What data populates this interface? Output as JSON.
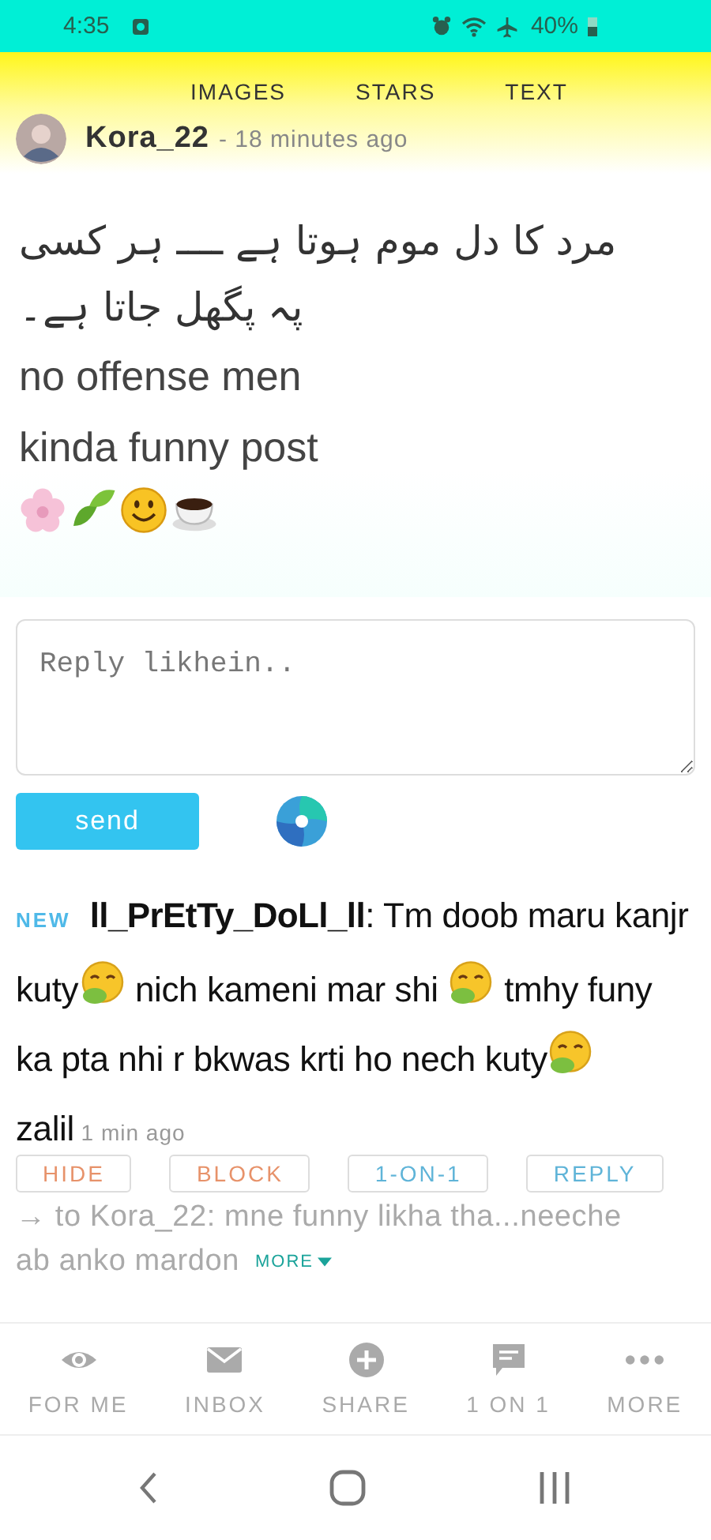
{
  "status_bar": {
    "time": "4:35",
    "battery": "40%"
  },
  "tabs": [
    {
      "label": "IMAGES",
      "selected": false
    },
    {
      "label": "STARS",
      "selected": false
    },
    {
      "label": "TEXT",
      "selected": false
    }
  ],
  "post": {
    "author": "Kora_22",
    "time": "- 18 minutes ago",
    "lines": [
      {
        "kind": "urdu",
        "text": "مرد کا دل موم ہوتا ہے ــــ ہر کسی پہ پگھل جاتا ہے۔"
      },
      {
        "kind": "plain",
        "text": "no offense men"
      },
      {
        "kind": "plain",
        "text": "kinda funny post"
      }
    ],
    "emojis": [
      {
        "kind": "flower"
      },
      {
        "kind": "leaf"
      },
      {
        "kind": "smile"
      },
      {
        "kind": "coffee"
      }
    ]
  },
  "reply_box": {
    "placeholder": "Reply likhein.."
  },
  "send_button": "send",
  "comment": {
    "badge": "NEW",
    "author": "ll_PrEtTy_DoLl_ll",
    "parts": [
      {
        "kind": "text",
        "text": ": Tm doob maru kanjr kuty"
      },
      {
        "kind": "emoji"
      },
      {
        "kind": "text",
        "text": " nich kameni mar shi "
      },
      {
        "kind": "emoji"
      },
      {
        "kind": "text",
        "text": " tmhy funy ka pta nhi r bkwas krti ho nech kuty"
      },
      {
        "kind": "emoji"
      },
      {
        "kind": "text",
        "text": " zalil"
      }
    ],
    "time": "1 min ago",
    "actions": [
      {
        "label": "HIDE",
        "kind": "warn"
      },
      {
        "label": "BLOCK",
        "kind": "warn"
      },
      {
        "label": "1-ON-1",
        "kind": "info"
      },
      {
        "label": "REPLY",
        "kind": "info"
      }
    ],
    "reply_to": [
      "→ to Kora_22: mne funny likha tha...neeche",
      "ab anko mardon"
    ],
    "more": "MORE"
  },
  "bottom_nav": [
    {
      "label": "FOR ME",
      "kind": "eye"
    },
    {
      "label": "INBOX",
      "kind": "mail"
    },
    {
      "label": "SHARE",
      "kind": "plus"
    },
    {
      "label": "1 ON 1",
      "kind": "chat"
    },
    {
      "label": "MORE",
      "kind": "dots"
    }
  ]
}
